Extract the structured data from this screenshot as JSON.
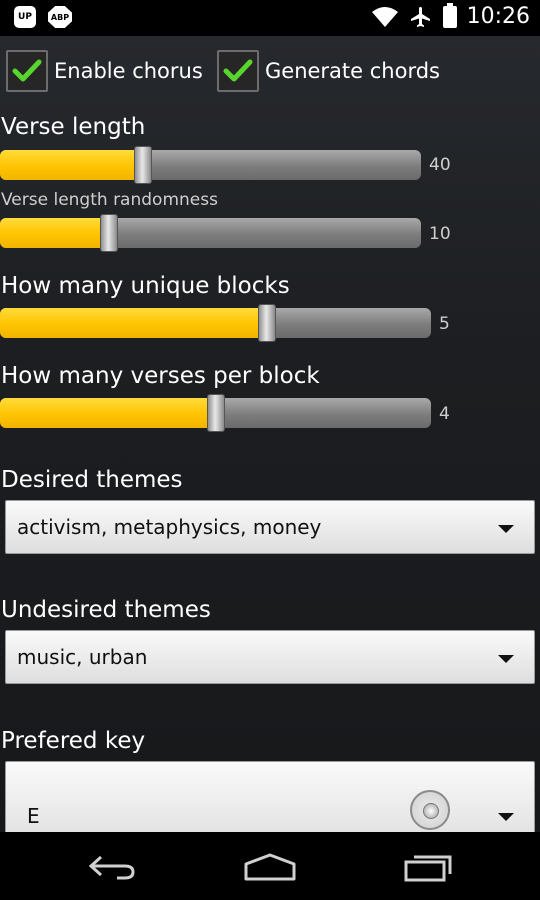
{
  "status_bar": {
    "left_icons": [
      "phone-app-icon",
      "abp-icon"
    ],
    "abp_label": "ABP",
    "phone_label": "UP",
    "right_icons": [
      "wifi-icon",
      "airplane-icon",
      "battery-icon"
    ],
    "time": "10:26"
  },
  "options": {
    "enable_chorus": {
      "label": "Enable chorus",
      "checked": true
    },
    "generate_chords": {
      "label": "Generate chords",
      "checked": true
    }
  },
  "sliders": {
    "verse_length": {
      "label": "Verse length",
      "value": "40",
      "fraction": 0.34
    },
    "verse_length_randomness": {
      "label": "Verse length randomness",
      "value": "10",
      "fraction": 0.26
    },
    "unique_blocks": {
      "label": "How many unique blocks",
      "value": "5",
      "fraction": 0.62
    },
    "verses_per_block": {
      "label": "How many verses per block",
      "value": "4",
      "fraction": 0.5
    }
  },
  "desired_themes": {
    "label": "Desired themes",
    "value": "activism, metaphysics, money"
  },
  "undesired_themes": {
    "label": "Undesired themes",
    "value": "music, urban"
  },
  "preferred_key": {
    "label": "Prefered key",
    "value": "E"
  },
  "nav": {
    "icons": [
      "back-icon",
      "home-icon",
      "recent-apps-icon"
    ]
  },
  "colors": {
    "accent": "#ffc400",
    "track": "#7d7d7d",
    "check": "#59d62d"
  }
}
